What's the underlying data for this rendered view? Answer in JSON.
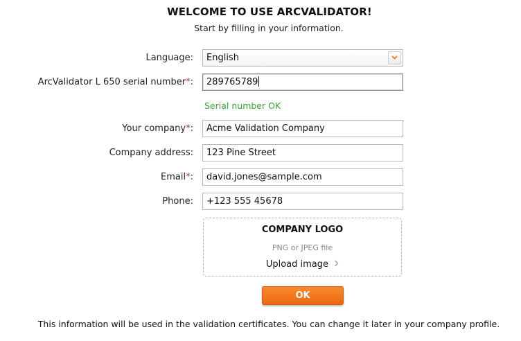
{
  "header": {
    "title": "WELCOME TO USE ARCVALIDATOR!",
    "subtitle": "Start by filling in your information."
  },
  "form": {
    "language": {
      "label": "Language:",
      "value": "English"
    },
    "serial": {
      "label": "ArcValidator L 650 serial number",
      "required_mark": "*",
      "suffix": ":",
      "value": "289765789",
      "status": "Serial number OK"
    },
    "company": {
      "label": "Your company",
      "required_mark": "*",
      "suffix": ":",
      "value": "Acme Validation Company"
    },
    "address": {
      "label": "Company address:",
      "value": "123 Pine Street"
    },
    "email": {
      "label": "Email",
      "required_mark": "*",
      "suffix": ":",
      "value": "david.jones@sample.com"
    },
    "phone": {
      "label": "Phone:",
      "value": "+123 555 45678"
    }
  },
  "logo": {
    "title": "COMPANY LOGO",
    "hint": "PNG or JPEG file",
    "upload_label": "Upload image"
  },
  "actions": {
    "ok_label": "OK"
  },
  "footer": {
    "text": "This information will be used in the validation certificates. You can change it later in your company profile."
  },
  "colors": {
    "accent": "#ef6f16",
    "required": "#d9232e",
    "success": "#3aa23a"
  }
}
